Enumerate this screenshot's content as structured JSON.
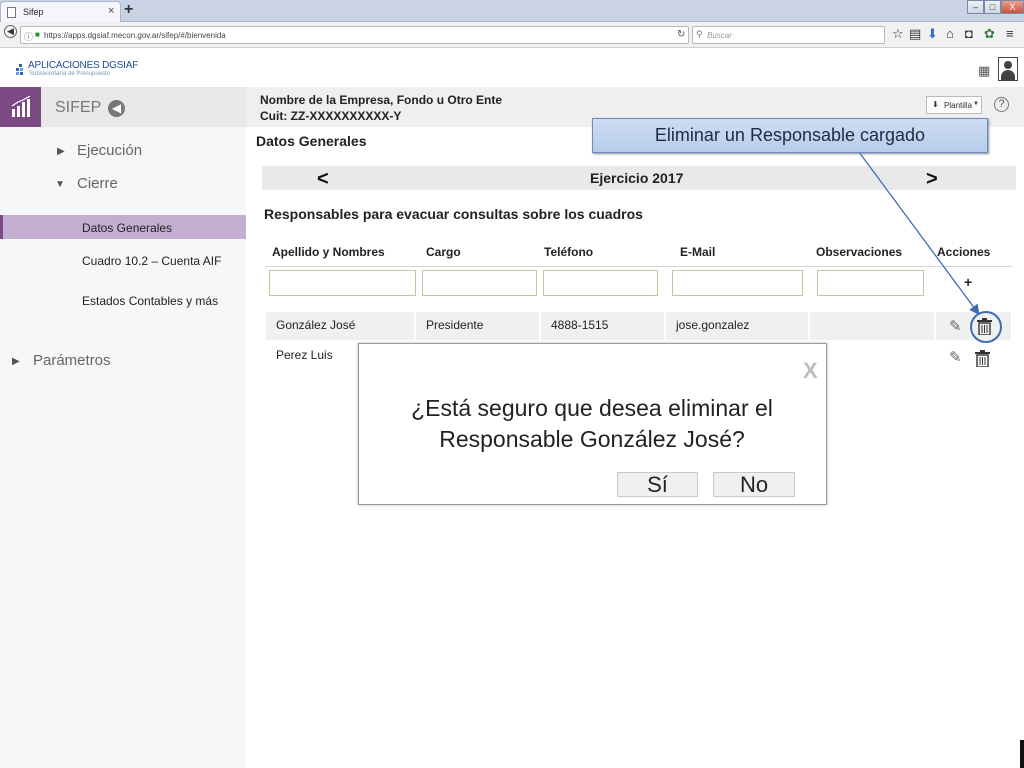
{
  "browser": {
    "tab_title": "Sifep",
    "tab_close": "×",
    "new_tab": "+",
    "url": "https://apps.dgsiaf.mecon.gov.ar/sifep/#/bienvenida",
    "search_placeholder": "Buscar",
    "window_controls": {
      "minimize": "–",
      "maximize": "□",
      "close": "X"
    }
  },
  "header": {
    "logo_name": "APLICACIONES DGSIAF",
    "logo_subtitle": "Subsecretaría de Presupuesto"
  },
  "sidebar": {
    "brand": "SIFEP",
    "nav": [
      {
        "label": "Ejecución",
        "caret": "▶"
      },
      {
        "label": "Cierre",
        "caret": "▼"
      },
      {
        "label": "Parámetros",
        "caret": "▶"
      }
    ],
    "subitems": [
      "Datos Generales",
      "Cuadro 10.2  – Cuenta AIF",
      "Estados Contables y más"
    ]
  },
  "main": {
    "company_name": "Nombre de la Empresa, Fondo u Otro Ente",
    "cuit": "Cuit: ZZ-XXXXXXXXXX-Y",
    "plantilla_label": "Plantilla",
    "help": "?",
    "section_title": "Datos Generales",
    "prev": "<",
    "next": ">",
    "year_label": "Ejercicio 2017",
    "table_title": "Responsables para evacuar consultas sobre los cuadros",
    "columns": [
      "Apellido y Nombres",
      "Cargo",
      "Teléfono",
      "E-Mail",
      "Observaciones",
      "Acciones"
    ],
    "add_label": "+",
    "rows": [
      {
        "name": "González José",
        "cargo": "Presidente",
        "telefono": "4888-1515",
        "email": "jose.gonzalez",
        "obs": ""
      },
      {
        "name": "Perez Luis",
        "cargo": "",
        "telefono": "",
        "email": "",
        "obs": ""
      }
    ]
  },
  "callout": {
    "text": "Eliminar un Responsable cargado"
  },
  "modal": {
    "close": "X",
    "message_line1": "¿Está seguro que desea eliminar el",
    "message_line2": "Responsable González José?",
    "yes": "Sí",
    "no": "No"
  },
  "colors": {
    "accent": "#7b4a84",
    "active_item": "#c3add0",
    "callout": "#c4d6ee",
    "highlight_ring": "#3b6db0"
  }
}
